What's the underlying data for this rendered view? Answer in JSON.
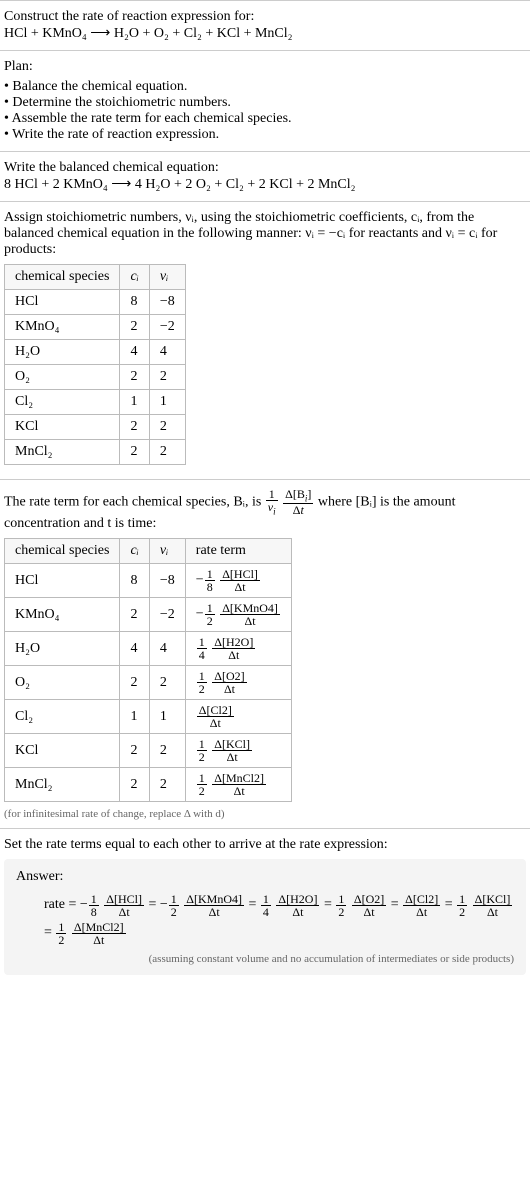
{
  "prompt": {
    "line1": "Construct the rate of reaction expression for:",
    "equation": "HCl + KMnO₄  ⟶  H₂O + O₂ + Cl₂ + KCl + MnCl₂"
  },
  "plan": {
    "heading": "Plan:",
    "items": [
      "Balance the chemical equation.",
      "Determine the stoichiometric numbers.",
      "Assemble the rate term for each chemical species.",
      "Write the rate of reaction expression."
    ]
  },
  "balanced": {
    "heading": "Write the balanced chemical equation:",
    "equation": "8 HCl + 2 KMnO₄  ⟶  4 H₂O + 2 O₂ + Cl₂ + 2 KCl + 2 MnCl₂"
  },
  "stoich_intro": "Assign stoichiometric numbers, νᵢ, using the stoichiometric coefficients, cᵢ, from the balanced chemical equation in the following manner: νᵢ = −cᵢ for reactants and νᵢ = cᵢ for products:",
  "stoich_table": {
    "headers": {
      "species": "chemical species",
      "ci": "cᵢ",
      "vi": "νᵢ"
    },
    "rows": [
      {
        "species": "HCl",
        "ci": "8",
        "vi": "−8"
      },
      {
        "species": "KMnO₄",
        "ci": "2",
        "vi": "−2"
      },
      {
        "species": "H₂O",
        "ci": "4",
        "vi": "4"
      },
      {
        "species": "O₂",
        "ci": "2",
        "vi": "2"
      },
      {
        "species": "Cl₂",
        "ci": "1",
        "vi": "1"
      },
      {
        "species": "KCl",
        "ci": "2",
        "vi": "2"
      },
      {
        "species": "MnCl₂",
        "ci": "2",
        "vi": "2"
      }
    ]
  },
  "rate_term_intro_a": "The rate term for each chemical species, Bᵢ, is ",
  "rate_term_intro_b": " where [Bᵢ] is the amount concentration and t is time:",
  "rate_table": {
    "headers": {
      "species": "chemical species",
      "ci": "cᵢ",
      "vi": "νᵢ",
      "rate": "rate term"
    },
    "rows": [
      {
        "species": "HCl",
        "ci": "8",
        "vi": "−8",
        "coef_num": "1",
        "coef_den": "8",
        "neg": true,
        "d_num": "Δ[HCl]",
        "d_den": "Δt"
      },
      {
        "species": "KMnO₄",
        "ci": "2",
        "vi": "−2",
        "coef_num": "1",
        "coef_den": "2",
        "neg": true,
        "d_num": "Δ[KMnO4]",
        "d_den": "Δt"
      },
      {
        "species": "H₂O",
        "ci": "4",
        "vi": "4",
        "coef_num": "1",
        "coef_den": "4",
        "neg": false,
        "d_num": "Δ[H2O]",
        "d_den": "Δt"
      },
      {
        "species": "O₂",
        "ci": "2",
        "vi": "2",
        "coef_num": "1",
        "coef_den": "2",
        "neg": false,
        "d_num": "Δ[O2]",
        "d_den": "Δt"
      },
      {
        "species": "Cl₂",
        "ci": "1",
        "vi": "1",
        "coef_num": "",
        "coef_den": "",
        "neg": false,
        "d_num": "Δ[Cl2]",
        "d_den": "Δt"
      },
      {
        "species": "KCl",
        "ci": "2",
        "vi": "2",
        "coef_num": "1",
        "coef_den": "2",
        "neg": false,
        "d_num": "Δ[KCl]",
        "d_den": "Δt"
      },
      {
        "species": "MnCl₂",
        "ci": "2",
        "vi": "2",
        "coef_num": "1",
        "coef_den": "2",
        "neg": false,
        "d_num": "Δ[MnCl2]",
        "d_den": "Δt"
      }
    ]
  },
  "rate_footnote": "(for infinitesimal rate of change, replace Δ with d)",
  "final_intro": "Set the rate terms equal to each other to arrive at the rate expression:",
  "answer": {
    "label": "Answer:",
    "prefix": "rate = ",
    "note": "(assuming constant volume and no accumulation of intermediates or side products)"
  },
  "chart_data": {
    "type": "table",
    "title": "Stoichiometric coefficients and rate terms",
    "tables": [
      {
        "name": "stoichiometric numbers",
        "columns": [
          "chemical species",
          "c_i",
          "ν_i"
        ],
        "rows": [
          [
            "HCl",
            8,
            -8
          ],
          [
            "KMnO4",
            2,
            -2
          ],
          [
            "H2O",
            4,
            4
          ],
          [
            "O2",
            2,
            2
          ],
          [
            "Cl2",
            1,
            1
          ],
          [
            "KCl",
            2,
            2
          ],
          [
            "MnCl2",
            2,
            2
          ]
        ]
      },
      {
        "name": "rate terms",
        "columns": [
          "chemical species",
          "c_i",
          "ν_i",
          "rate term"
        ],
        "rows": [
          [
            "HCl",
            8,
            -8,
            "-(1/8) Δ[HCl]/Δt"
          ],
          [
            "KMnO4",
            2,
            -2,
            "-(1/2) Δ[KMnO4]/Δt"
          ],
          [
            "H2O",
            4,
            4,
            "(1/4) Δ[H2O]/Δt"
          ],
          [
            "O2",
            2,
            2,
            "(1/2) Δ[O2]/Δt"
          ],
          [
            "Cl2",
            1,
            1,
            "Δ[Cl2]/Δt"
          ],
          [
            "KCl",
            2,
            2,
            "(1/2) Δ[KCl]/Δt"
          ],
          [
            "MnCl2",
            2,
            2,
            "(1/2) Δ[MnCl2]/Δt"
          ]
        ]
      }
    ],
    "rate_expression": "rate = -(1/8) Δ[HCl]/Δt = -(1/2) Δ[KMnO4]/Δt = (1/4) Δ[H2O]/Δt = (1/2) Δ[O2]/Δt = Δ[Cl2]/Δt = (1/2) Δ[KCl]/Δt = (1/2) Δ[MnCl2]/Δt"
  }
}
